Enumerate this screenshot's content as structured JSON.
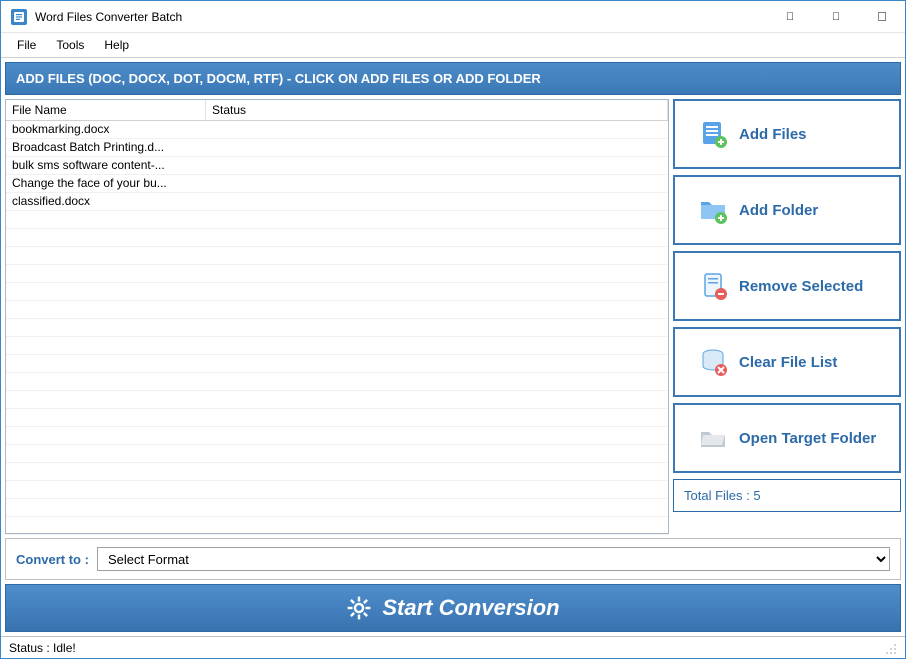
{
  "app": {
    "title": "Word Files Converter Batch"
  },
  "menu": {
    "file": "File",
    "tools": "Tools",
    "help": "Help"
  },
  "instruction": "ADD FILES (DOC, DOCX, DOT, DOCM, RTF) - CLICK ON ADD FILES OR ADD FOLDER",
  "columns": {
    "name": "File Name",
    "status": "Status"
  },
  "files": [
    {
      "name": "bookmarking.docx",
      "status": ""
    },
    {
      "name": "Broadcast Batch Printing.d...",
      "status": ""
    },
    {
      "name": "bulk sms software content-...",
      "status": ""
    },
    {
      "name": "Change the face of your bu...",
      "status": ""
    },
    {
      "name": "classified.docx",
      "status": ""
    }
  ],
  "buttons": {
    "add_files": "Add Files",
    "add_folder": "Add Folder",
    "remove_selected": "Remove Selected",
    "clear_list": "Clear File List",
    "open_target": "Open Target Folder"
  },
  "total_label": "Total Files : 5",
  "convert": {
    "label": "Convert to :",
    "placeholder": "Select Format"
  },
  "start_label": "Start Conversion",
  "status_text": "Status  :  Idle!"
}
